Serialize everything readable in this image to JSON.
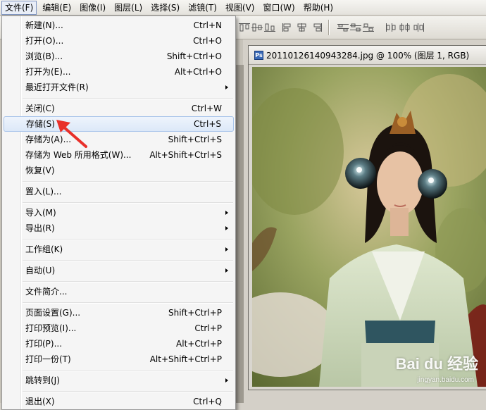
{
  "menubar": {
    "items": [
      {
        "label": "文件(F)",
        "active": true
      },
      {
        "label": "编辑(E)"
      },
      {
        "label": "图像(I)"
      },
      {
        "label": "图层(L)"
      },
      {
        "label": "选择(S)"
      },
      {
        "label": "滤镜(T)"
      },
      {
        "label": "视图(V)"
      },
      {
        "label": "窗口(W)"
      },
      {
        "label": "帮助(H)"
      }
    ]
  },
  "file_menu": {
    "items": [
      {
        "label": "新建(N)...",
        "shortcut": "Ctrl+N"
      },
      {
        "label": "打开(O)...",
        "shortcut": "Ctrl+O"
      },
      {
        "label": "浏览(B)...",
        "shortcut": "Shift+Ctrl+O"
      },
      {
        "label": "打开为(E)...",
        "shortcut": "Alt+Ctrl+O"
      },
      {
        "label": "最近打开文件(R)",
        "submenu": true
      },
      {
        "label": "关闭(C)",
        "shortcut": "Ctrl+W"
      },
      {
        "label": "存储(S)",
        "shortcut": "Ctrl+S",
        "highlighted": true
      },
      {
        "label": "存储为(A)...",
        "shortcut": "Shift+Ctrl+S"
      },
      {
        "label": "存储为 Web 所用格式(W)...",
        "shortcut": "Alt+Shift+Ctrl+S"
      },
      {
        "label": "恢复(V)"
      },
      {
        "label": "置入(L)..."
      },
      {
        "label": "导入(M)",
        "submenu": true
      },
      {
        "label": "导出(R)",
        "submenu": true
      },
      {
        "label": "工作组(K)",
        "submenu": true
      },
      {
        "label": "自动(U)",
        "submenu": true
      },
      {
        "label": "文件简介..."
      },
      {
        "label": "页面设置(G)...",
        "shortcut": "Shift+Ctrl+P"
      },
      {
        "label": "打印预览(I)...",
        "shortcut": "Ctrl+P"
      },
      {
        "label": "打印(P)...",
        "shortcut": "Alt+Ctrl+P"
      },
      {
        "label": "打印一份(T)",
        "shortcut": "Alt+Shift+Ctrl+P"
      },
      {
        "label": "跳转到(J)",
        "submenu": true
      },
      {
        "label": "退出(X)",
        "shortcut": "Ctrl+Q"
      }
    ]
  },
  "document": {
    "title": "20110126140943284.jpg @ 100% (图层 1, RGB)",
    "icon": "ps-document-icon",
    "icon_glyph": "Ps"
  },
  "watermark": {
    "brand": "Bai du 经验",
    "url": "jingyan.baidu.com"
  },
  "colors": {
    "menu_highlight_border": "#a8c4ea",
    "annotation_red": "#e8302a"
  }
}
